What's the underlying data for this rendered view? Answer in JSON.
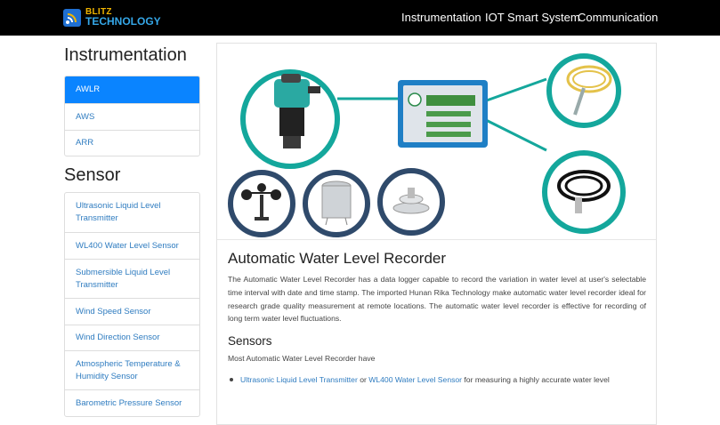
{
  "brand": {
    "line1": "BLITZ",
    "line2": "TECHNOLOGY"
  },
  "nav": [
    "Instrumentation",
    "IOT Smart System",
    "Communication"
  ],
  "sidebar": {
    "instrumentation_title": "Instrumentation",
    "instrumentation_items": [
      "AWLR",
      "AWS",
      "ARR"
    ],
    "sensor_title": "Sensor",
    "sensor_items": [
      "Ultrasonic Liquid Level Transmitter",
      "WL400 Water Level Sensor",
      "Submersible Liquid Level Transmitter",
      "Wind Speed Sensor",
      "Wind Direction Sensor",
      "Atmospheric Temperature & Humidity Sensor",
      "Barometric Pressure Sensor"
    ]
  },
  "main": {
    "title": "Automatic Water Level Recorder",
    "paragraph": "The Automatic Water Level Recorder has a data logger capable to record the variation in water level at user's selectable time interval with date and time stamp. The imported Hunan Rika Technology make automatic water level recorder ideal for research grade quality measurement at remote locations. The automatic water level recorder is effective for recording of long term water level fluctuations.",
    "sensors_heading": "Sensors",
    "sensors_intro": "Most Automatic Water Level Recorder have",
    "bullet": {
      "link1": "Ultrasonic Liquid Level Transmitter",
      "or": "or",
      "link2": "WL400 Water Level Sensor",
      "rest": "for measuring a highly accurate water level"
    }
  },
  "colors": {
    "navbar": "#000000",
    "active": "#0a84ff",
    "link": "#2f7cc0",
    "teal_ring": "#14a79c",
    "navy_ring": "#2f4a6b"
  }
}
